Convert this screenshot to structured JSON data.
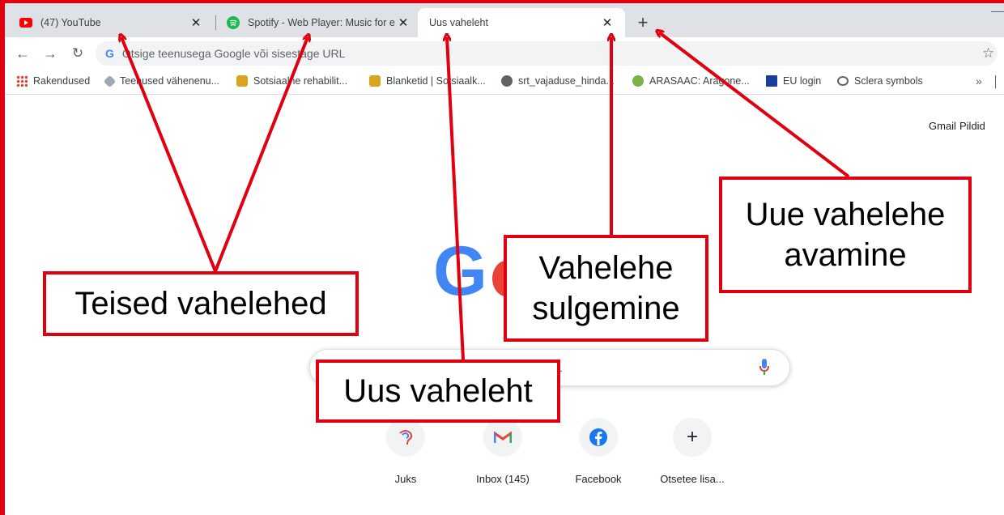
{
  "tabs": [
    {
      "title": "(47) YouTube",
      "favicon": "youtube-icon",
      "color": "#ff0000"
    },
    {
      "title": "Spotify - Web Player: Music for e",
      "favicon": "spotify-icon",
      "color": "#1db954"
    },
    {
      "title": "Uus vaheleht",
      "favicon": "",
      "active": true
    }
  ],
  "toolbar": {
    "omnibox_placeholder": "Otsige teenusega Google või sisestage URL",
    "google_g": "G"
  },
  "bookmarks": [
    {
      "label": "Rakendused",
      "icon": "apps-grid-icon"
    },
    {
      "label": "Teenused vähenenu...",
      "icon": "bookmark-icon"
    },
    {
      "label": "Sotsiaalne rehabilit...",
      "icon": "estonia-crest-icon"
    },
    {
      "label": "Blanketid | Sotsiaalk...",
      "icon": "estonia-crest-icon"
    },
    {
      "label": "srt_vajaduse_hinda...",
      "icon": "globe-icon"
    },
    {
      "label": "ARASAAC: Aragone...",
      "icon": "arasaac-icon"
    },
    {
      "label": "EU login",
      "icon": "eu-flag-icon"
    },
    {
      "label": "Sclera symbols",
      "icon": "eye-icon"
    }
  ],
  "bookmarks_more": "»",
  "page": {
    "gmail": "Gmail",
    "images": "Pildid",
    "search_placeholder_visible": "RL",
    "shortcuts": [
      {
        "label": "Juks",
        "icon": "juks-icon"
      },
      {
        "label": "Inbox (145)",
        "icon": "gmail-icon"
      },
      {
        "label": "Facebook",
        "icon": "facebook-icon"
      },
      {
        "label": "Otsetee lisa...",
        "icon": "plus-icon"
      }
    ]
  },
  "annotations": {
    "other_tabs": "Teised vahelehed",
    "new_tab": "Uus vaheleht",
    "close_tab_line1": "Vahelehe",
    "close_tab_line2": "sulgemine",
    "open_new_tab_line1": "Uue vahelehe",
    "open_new_tab_line2": "avamine"
  },
  "colors": {
    "annotation_red": "#e0000f",
    "google_blue": "#4285f4",
    "google_red": "#ea4335"
  }
}
